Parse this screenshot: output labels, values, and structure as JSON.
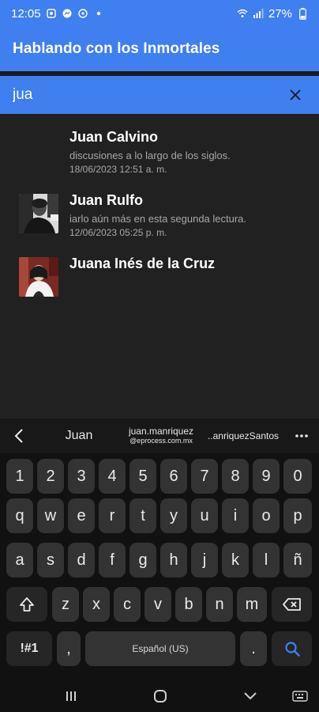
{
  "status_bar": {
    "time": "12:05",
    "battery": "27%"
  },
  "app": {
    "title": "Hablando con los Inmortales"
  },
  "search": {
    "value": "jua",
    "placeholder": ""
  },
  "results": [
    {
      "name": "Juan Calvino",
      "snippet": " discusiones a lo largo de los siglos.",
      "date": "18/06/2023 12:51 a. m."
    },
    {
      "name": "Juan Rulfo",
      "snippet": "iarlo aún más en esta segunda lectura.",
      "date": "12/06/2023 05:25 p. m."
    },
    {
      "name": "Juana Inés de la Cruz",
      "snippet": "",
      "date": ""
    }
  ],
  "keyboard": {
    "suggestions": {
      "s1": "Juan",
      "s2_main": "juan.manriquez",
      "s2_sub": "@eprocess.com.mx",
      "s3": "..anriquezSantos"
    },
    "row_numbers": [
      "1",
      "2",
      "3",
      "4",
      "5",
      "6",
      "7",
      "8",
      "9",
      "0"
    ],
    "row1": [
      "q",
      "w",
      "e",
      "r",
      "t",
      "y",
      "u",
      "i",
      "o",
      "p"
    ],
    "row2": [
      "a",
      "s",
      "d",
      "f",
      "g",
      "h",
      "j",
      "k",
      "l",
      "ñ"
    ],
    "row3": [
      "z",
      "x",
      "c",
      "v",
      "b",
      "n",
      "m"
    ],
    "symbols_label": "!#1",
    "comma": ",",
    "space_label": "Español (US)",
    "period": "."
  },
  "colors": {
    "accent": "#3f7ff0",
    "background": "#212121",
    "keyboard": "#111111"
  }
}
